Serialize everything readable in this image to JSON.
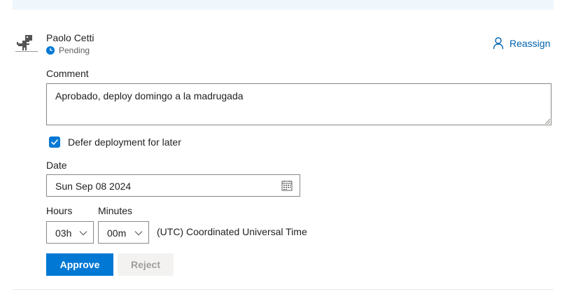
{
  "approver": {
    "name": "Paolo Cetti",
    "status": "Pending"
  },
  "reassign": {
    "label": "Reassign"
  },
  "comment": {
    "label": "Comment",
    "value": "Aprobado, deploy domingo a la madrugada"
  },
  "defer": {
    "label": "Defer deployment for later",
    "checked": true
  },
  "date": {
    "label": "Date",
    "value": "Sun Sep 08 2024"
  },
  "hours": {
    "label": "Hours",
    "value": "03h"
  },
  "minutes": {
    "label": "Minutes",
    "value": "00m"
  },
  "timezone": "(UTC) Coordinated Universal Time",
  "actions": {
    "approve_label": "Approve",
    "reject_label": "Reject"
  },
  "colors": {
    "accent": "#0078d4",
    "link": "#0062ad",
    "disabled_bg": "#f3f2f1"
  },
  "icons": {
    "avatar": "dinosaur-avatar",
    "status": "clock-icon",
    "reassign": "person-icon",
    "date": "calendar-icon",
    "select": "chevron-down-icon",
    "checkbox": "checkmark-icon"
  }
}
